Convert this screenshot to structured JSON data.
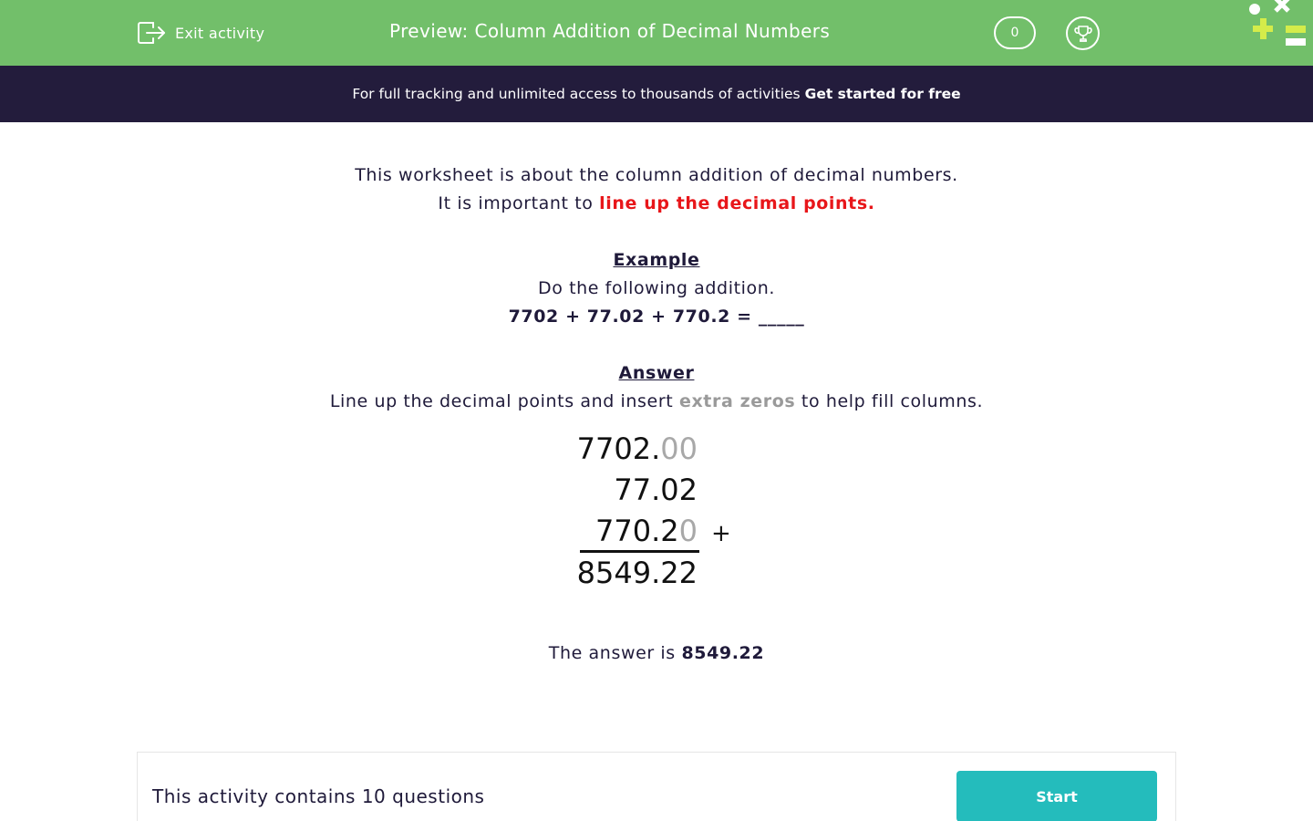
{
  "header": {
    "exit_label": "Exit activity",
    "title": "Preview: Column Addition of Decimal Numbers",
    "score": "0",
    "icons": {
      "exit": "exit-icon",
      "trophy": "trophy-icon",
      "logo": "maths-symbols-logo"
    }
  },
  "banner": {
    "text": "For full tracking and unlimited access to thousands of activities",
    "link": "Get started for free"
  },
  "intro": {
    "line1": "This worksheet is about the column addition of decimal numbers.",
    "line2_prefix": "It is important to",
    "line2_highlight": "line up the decimal points."
  },
  "example": {
    "heading": "Example",
    "instruction": "Do the following addition.",
    "expression": "7702 + 77.02 + 770.2 = _____"
  },
  "answer": {
    "heading": "Answer",
    "text_prefix": "Line up the decimal points and insert",
    "text_highlight": "extra zeros",
    "text_suffix": "to help fill columns.",
    "rows": [
      {
        "main": "7702.",
        "padding": "00"
      },
      {
        "main": "77.02",
        "padding": ""
      },
      {
        "main": "770.2",
        "padding": "0"
      }
    ],
    "operator": "+",
    "total": "8549.22",
    "final_prefix": "The answer is",
    "final_value": "8549.22"
  },
  "footer": {
    "text": "This activity contains 10 questions",
    "start_label": "Start"
  },
  "colors": {
    "header_green": "#72bf6a",
    "banner_navy": "#231c3c",
    "highlight_red": "#e8161a",
    "start_teal": "#24bcbc",
    "text_dark": "#1f1a3a"
  }
}
